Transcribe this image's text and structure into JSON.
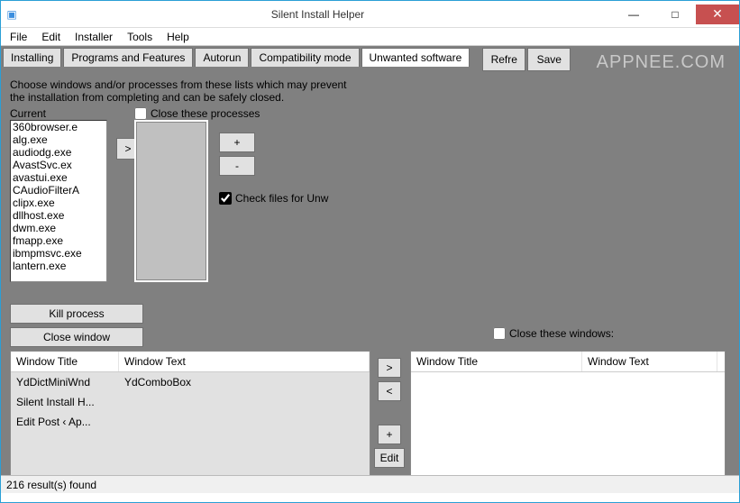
{
  "window": {
    "title": "Silent Install Helper",
    "minimize": "—",
    "maximize": "□",
    "close": "✕"
  },
  "menu": {
    "file": "File",
    "edit": "Edit",
    "installer": "Installer",
    "tools": "Tools",
    "help": "Help"
  },
  "tabs": {
    "installing": "Installing",
    "programs": "Programs and Features",
    "autorun": "Autorun",
    "compat": "Compatibility mode",
    "unwanted": "Unwanted software"
  },
  "topButtons": {
    "refresh": "Refre",
    "save": "Save"
  },
  "watermark": "APPNEE.COM",
  "instructions": "Choose windows and/or processes from these lists which may prevent the installation from completing and can be safely closed.",
  "labels": {
    "current": "Current",
    "closeProcesses": "Close these processes",
    "checkFilesUnw": "Check files for Unw",
    "killProcess": "Kill process",
    "closeWindow": "Close window",
    "closeWindows": "Close these windows:",
    "windowTitle": "Window Title",
    "windowText": "Window Text",
    "moveRight": ">",
    "moveLeft": "<",
    "plus": "+",
    "minus": "-",
    "edit": "Edit"
  },
  "checkboxes": {
    "closeProcesses": false,
    "checkFilesUnw": true,
    "closeWindows": false
  },
  "processList": [
    "360browser.e",
    "alg.exe",
    "audiodg.exe",
    "AvastSvc.ex",
    "avastui.exe",
    "CAudioFilterA",
    "clipx.exe",
    "dllhost.exe",
    "dwm.exe",
    "fmapp.exe",
    "ibmpmsvc.exe",
    "lantern.exe"
  ],
  "leftTable": {
    "rows": [
      {
        "title": "YdDictMiniWnd",
        "text": "YdComboBox"
      },
      {
        "title": "Silent Install H...",
        "text": ""
      },
      {
        "title": "Edit Post ‹ Ap...",
        "text": ""
      }
    ]
  },
  "statusbar": "216 result(s) found"
}
